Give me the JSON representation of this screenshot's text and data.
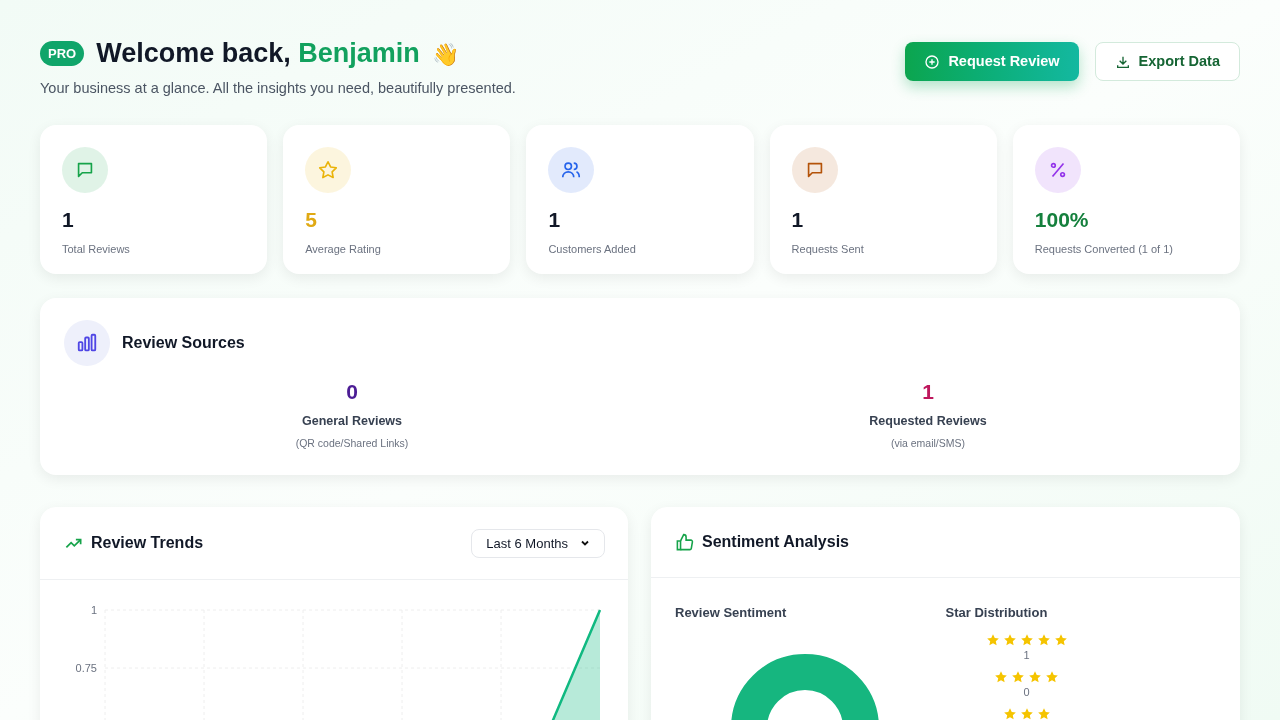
{
  "header": {
    "badge": "PRO",
    "greeting": "Welcome back,",
    "name": "Benjamin",
    "emoji": "👋",
    "subtitle": "Your business at a glance. All the insights you need, beautifully presented."
  },
  "actions": [
    {
      "kind": "primary",
      "label": "Request Review"
    },
    {
      "kind": "secondary",
      "label": "Export Data"
    }
  ],
  "stats": [
    {
      "kind": "message",
      "value": "1",
      "label": "Total Reviews",
      "color": "#16a34a"
    },
    {
      "kind": "star",
      "value": "5",
      "label": "Average Rating",
      "color": "#eab308"
    },
    {
      "kind": "users",
      "value": "1",
      "label": "Customers Added",
      "color": "#2563eb"
    },
    {
      "kind": "message",
      "value": "1",
      "label": "Requests Sent",
      "color": "#b45309"
    },
    {
      "kind": "percent",
      "value": "100%",
      "label": "Requests Converted (1 of 1)",
      "color": "#9333ea"
    }
  ],
  "review_sources": {
    "title": "Review Sources",
    "items": [
      {
        "value": "0",
        "label": "General Reviews",
        "note": "(QR code/Shared Links)",
        "color": "#4c1d95"
      },
      {
        "value": "1",
        "label": "Requested Reviews",
        "note": "(via email/SMS)",
        "color": "#be185d"
      }
    ]
  },
  "review_trends": {
    "title": "Review Trends",
    "period": "Last 6 Months",
    "chart_data": {
      "type": "area",
      "ylim": [
        0,
        1
      ],
      "yticks": [
        0.75,
        1
      ],
      "series": [
        {
          "color": "#10b981",
          "values": [
            0,
            0,
            0,
            0,
            0,
            1
          ]
        }
      ]
    }
  },
  "sentiment": {
    "title": "Sentiment Analysis",
    "sentiment_heading": "Review Sentiment",
    "distribution_heading": "Star Distribution",
    "distribution": [
      {
        "stars": 5,
        "count": "1"
      },
      {
        "stars": 4,
        "count": "0"
      },
      {
        "stars": 3
      }
    ]
  }
}
